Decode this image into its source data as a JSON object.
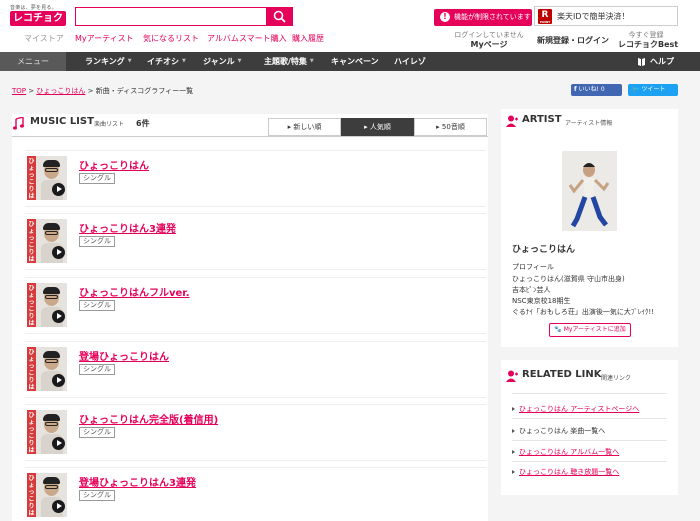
{
  "header": {
    "tagline": "音楽は、夢を見る。",
    "logo": "レコチョク",
    "search": {
      "placeholder": "",
      "value": ""
    },
    "subnav": [
      "マイストア",
      "Myアーティスト",
      "気になるリスト",
      "アルバムスマート購入",
      "購入履歴"
    ],
    "alert": "機能が制限されています",
    "rakuten": {
      "logo": "R",
      "logo_sub": "POINT",
      "text": "楽天IDで簡単決済！"
    },
    "login_status": "ログインしていません",
    "mypage": "Myページ",
    "register": "新規登録・ログイン",
    "best_small": "今すぐ登録",
    "best": "レコチョクBest"
  },
  "mainnav": {
    "menu": "メニュー",
    "items": [
      "ランキング",
      "イチオシ",
      "ジャンル",
      "主題歌/特集",
      "キャンペーン",
      "ハイレゾ"
    ],
    "help": "ヘルプ"
  },
  "breadcrumb": {
    "top": "TOP",
    "artist": "ひょっこりはん",
    "current": "新曲・ディスコグラフィー一覧"
  },
  "social": {
    "like": "いいね! 0",
    "tweet": "ツイート"
  },
  "music_list": {
    "title": "MUSIC LIST",
    "subtitle": "楽曲リスト",
    "count": "6件",
    "sort_tabs": [
      "新しい順",
      "人気順",
      "50音順"
    ],
    "thumb_text": "ひょっこりはん",
    "tracks": [
      {
        "title": "ひょっこりはん",
        "type": "シングル"
      },
      {
        "title": "ひょっこりはん3連発",
        "type": "シングル"
      },
      {
        "title": "ひょっこりはんフルver.",
        "type": "シングル"
      },
      {
        "title": "登場ひょっこりはん",
        "type": "シングル"
      },
      {
        "title": "ひょっこりはん完全版(着信用)",
        "type": "シングル"
      },
      {
        "title": "登場ひょっこりはん3連発",
        "type": "シングル"
      }
    ]
  },
  "artist": {
    "title": "ARTIST",
    "subtitle": "アーティスト情報",
    "name": "ひょっこりはん",
    "profile_heading": "プロフィール",
    "profile_lines": [
      "ひょっこりはん(滋賀県 守山市出身)",
      "吉本ﾋﾟﾝ芸人",
      "NSC東京校18期生",
      "ぐるﾅｲ「おもしろ荘」出演後一気に大ﾌﾞﾚｲｸ!!"
    ],
    "add_button": "Myアーティストに追加"
  },
  "related": {
    "title": "RELATED LINK",
    "subtitle": "関連リンク",
    "links": [
      {
        "label": "ひょっこりはん アーティストページへ"
      },
      {
        "label": "ひょっこりはん 楽曲一覧へ"
      },
      {
        "label": "ひょっこりはん アルバム一覧へ"
      },
      {
        "label": "ひょっこりはん 聴き放題一覧へ"
      }
    ]
  },
  "colors": {
    "brand": "#e5005a",
    "nav": "#3d3d3d",
    "facebook": "#4267b2",
    "twitter": "#1da1f2"
  },
  "icons": [
    "search-icon",
    "alert-icon",
    "rakuten-point-icon",
    "menu-caret-icon",
    "help-book-icon",
    "music-note-icon",
    "artist-person-icon",
    "play-icon",
    "paw-icon",
    "triangle-bullet-icon"
  ]
}
